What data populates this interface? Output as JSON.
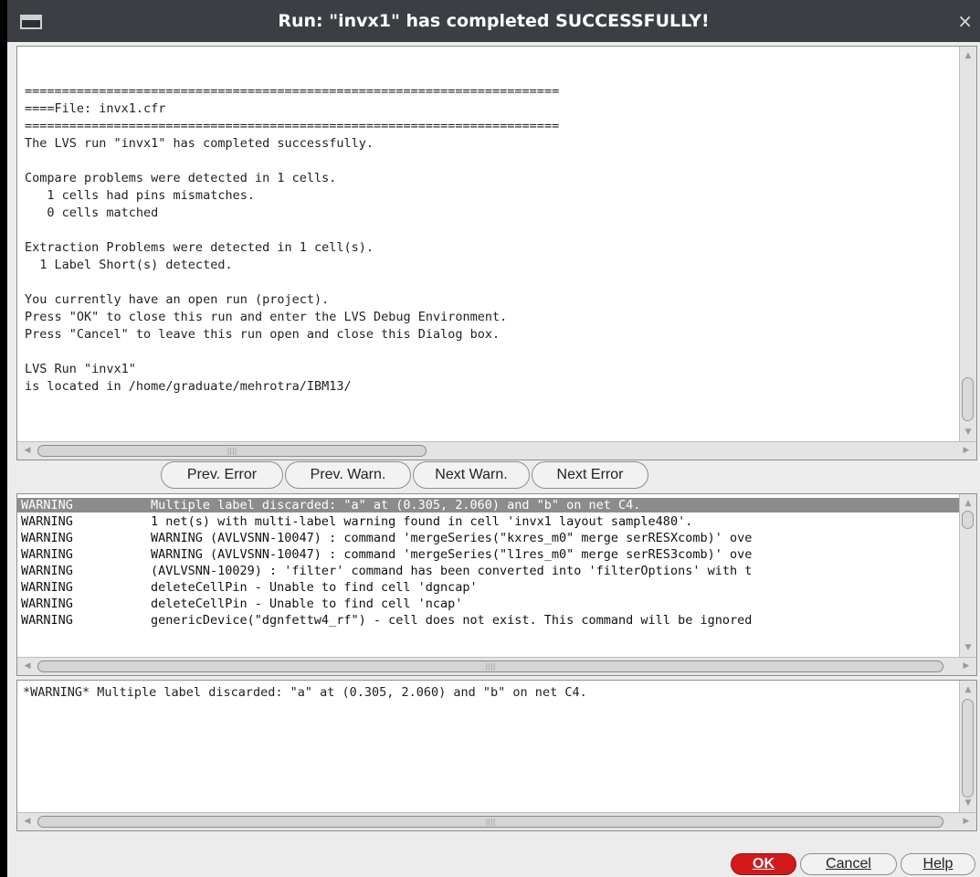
{
  "window": {
    "title": "Run: \"invx1\" has completed SUCCESSFULLY!",
    "close_glyph": "×"
  },
  "report": {
    "lines": [
      "========================================================================",
      "====File: invx1.cfr",
      "========================================================================",
      "The LVS run \"invx1\" has completed successfully.",
      "",
      "Compare problems were detected in 1 cells.",
      "   1 cells had pins mismatches.",
      "   0 cells matched",
      "",
      "Extraction Problems were detected in 1 cell(s).",
      "  1 Label Short(s) detected.",
      "",
      "You currently have an open run (project).",
      "Press \"OK\" to close this run and enter the LVS Debug Environment.",
      "Press \"Cancel\" to leave this run open and close this Dialog box.",
      "",
      "LVS Run \"invx1\"",
      "is located in /home/graduate/mehrotra/IBM13/"
    ]
  },
  "navigation": {
    "prev_error": "Prev. Error",
    "prev_warn": "Prev. Warn.",
    "next_warn": "Next Warn.",
    "next_error": "Next Error"
  },
  "messages": [
    {
      "severity": "WARNING",
      "text": "Multiple label discarded: \"a\" at (0.305, 2.060) and \"b\" on net C4.",
      "selected": true
    },
    {
      "severity": "WARNING",
      "text": "1 net(s) with multi-label warning found in cell 'invx1 layout sample480'.",
      "selected": false
    },
    {
      "severity": "WARNING",
      "text": "WARNING (AVLVSNN-10047) : command 'mergeSeries(\"kxres_m0\" merge serRESXcomb)' ove",
      "selected": false
    },
    {
      "severity": "WARNING",
      "text": "WARNING (AVLVSNN-10047) : command 'mergeSeries(\"l1res_m0\" merge serRES3comb)' ove",
      "selected": false
    },
    {
      "severity": "WARNING",
      "text": "(AVLVSNN-10029) : 'filter' command has been converted into 'filterOptions' with t",
      "selected": false
    },
    {
      "severity": "WARNING",
      "text": "deleteCellPin - Unable to find cell 'dgncap'",
      "selected": false
    },
    {
      "severity": "WARNING",
      "text": "deleteCellPin - Unable to find cell 'ncap'",
      "selected": false
    },
    {
      "severity": "WARNING",
      "text": "genericDevice(\"dgnfettw4_rf\") - cell does not exist. This command will be ignored",
      "selected": false
    }
  ],
  "detail": {
    "text": "*WARNING* Multiple label discarded: \"a\" at (0.305, 2.060) and \"b\" on net C4."
  },
  "buttons": {
    "ok": "OK",
    "cancel": "Cancel",
    "help": "Help"
  },
  "colors": {
    "titlebar": "#3b3f44",
    "ok_button": "#d21a1a",
    "selected_row": "#8c8c8c"
  },
  "icons": [
    "window-menu-icon",
    "close-icon",
    "scroll-up-arrow-icon",
    "scroll-down-arrow-icon",
    "scroll-left-arrow-icon",
    "scroll-right-arrow-icon"
  ]
}
